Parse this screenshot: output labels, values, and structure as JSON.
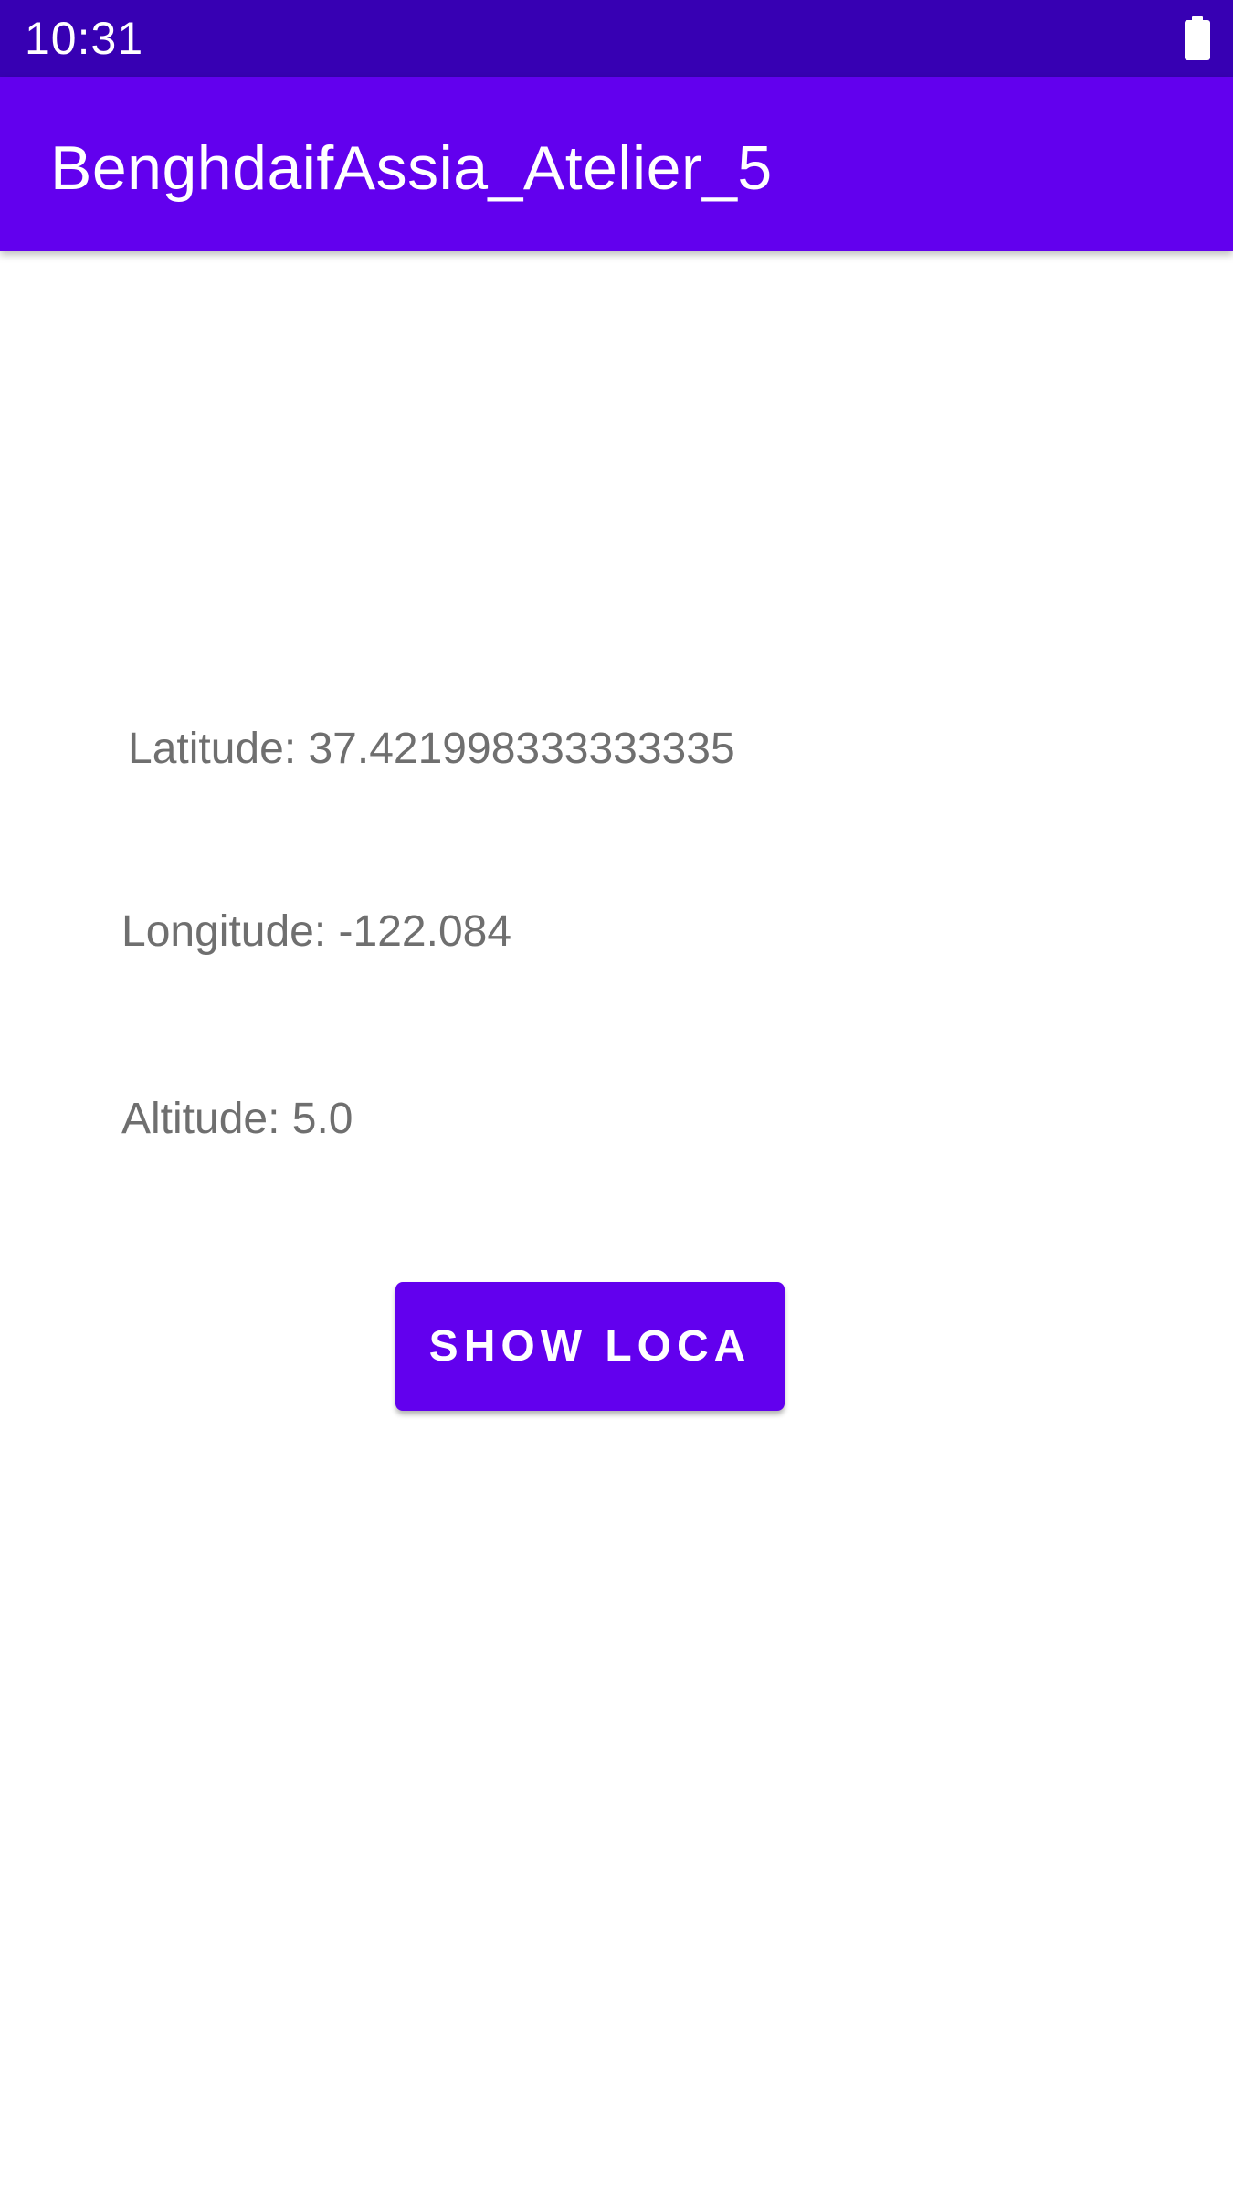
{
  "status_bar": {
    "time": "10:31",
    "battery_icon": "battery-full-icon"
  },
  "app_bar": {
    "title": "BenghdaifAssia_Atelier_5",
    "background_color": "#6200EE"
  },
  "location": {
    "latitude_text": "Latitude: 37.421998333333335",
    "longitude_text": "Longitude: -122.084",
    "altitude_text": "Altitude: 5.0"
  },
  "actions": {
    "show_location_label": "SHOW LOCA"
  },
  "colors": {
    "status_bar": "#3700B3",
    "primary": "#6200EE",
    "text_secondary": "#6f6f6f"
  }
}
